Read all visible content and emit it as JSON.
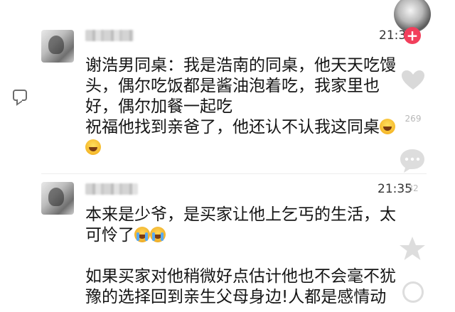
{
  "comments": [
    {
      "time": "21:32",
      "lines": [
        "谢浩男同桌：我是浩南的同桌，他天天吃馒",
        "头，偶尔吃饭都是酱油泡着吃，我家里也",
        "好，偶尔加餐一起吃",
        "祝福他找到亲爸了，他还认不认我这同桌"
      ],
      "emoji": "laughing-crying-emoji"
    },
    {
      "time": "21:35",
      "lines": [
        "本来是少爷，是买家让他上乞丐的生活，太",
        "可怜了"
      ],
      "emoji": "crying-emoji",
      "lines2": [
        "如果买家对他稍微好点估计他也不会毫不犹",
        "豫的选择回到亲生父母身边!人都是感情动"
      ]
    }
  ],
  "rail": {
    "follow_label": "+",
    "like_count": "269",
    "comment_count": "32"
  },
  "colors": {
    "follow": "#f23f5c"
  }
}
